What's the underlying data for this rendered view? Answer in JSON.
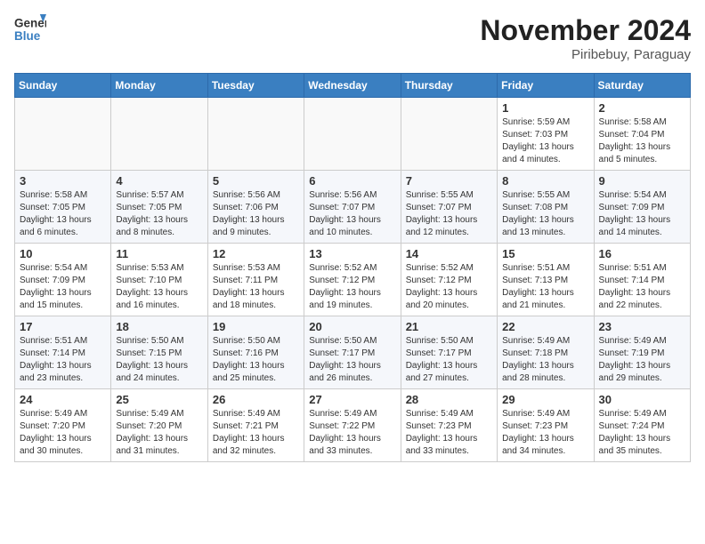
{
  "header": {
    "logo_general": "General",
    "logo_blue": "Blue",
    "month_title": "November 2024",
    "location": "Piribebuy, Paraguay"
  },
  "calendar": {
    "days_of_week": [
      "Sunday",
      "Monday",
      "Tuesday",
      "Wednesday",
      "Thursday",
      "Friday",
      "Saturday"
    ],
    "weeks": [
      [
        {
          "day": "",
          "info": ""
        },
        {
          "day": "",
          "info": ""
        },
        {
          "day": "",
          "info": ""
        },
        {
          "day": "",
          "info": ""
        },
        {
          "day": "",
          "info": ""
        },
        {
          "day": "1",
          "info": "Sunrise: 5:59 AM\nSunset: 7:03 PM\nDaylight: 13 hours\nand 4 minutes."
        },
        {
          "day": "2",
          "info": "Sunrise: 5:58 AM\nSunset: 7:04 PM\nDaylight: 13 hours\nand 5 minutes."
        }
      ],
      [
        {
          "day": "3",
          "info": "Sunrise: 5:58 AM\nSunset: 7:05 PM\nDaylight: 13 hours\nand 6 minutes."
        },
        {
          "day": "4",
          "info": "Sunrise: 5:57 AM\nSunset: 7:05 PM\nDaylight: 13 hours\nand 8 minutes."
        },
        {
          "day": "5",
          "info": "Sunrise: 5:56 AM\nSunset: 7:06 PM\nDaylight: 13 hours\nand 9 minutes."
        },
        {
          "day": "6",
          "info": "Sunrise: 5:56 AM\nSunset: 7:07 PM\nDaylight: 13 hours\nand 10 minutes."
        },
        {
          "day": "7",
          "info": "Sunrise: 5:55 AM\nSunset: 7:07 PM\nDaylight: 13 hours\nand 12 minutes."
        },
        {
          "day": "8",
          "info": "Sunrise: 5:55 AM\nSunset: 7:08 PM\nDaylight: 13 hours\nand 13 minutes."
        },
        {
          "day": "9",
          "info": "Sunrise: 5:54 AM\nSunset: 7:09 PM\nDaylight: 13 hours\nand 14 minutes."
        }
      ],
      [
        {
          "day": "10",
          "info": "Sunrise: 5:54 AM\nSunset: 7:09 PM\nDaylight: 13 hours\nand 15 minutes."
        },
        {
          "day": "11",
          "info": "Sunrise: 5:53 AM\nSunset: 7:10 PM\nDaylight: 13 hours\nand 16 minutes."
        },
        {
          "day": "12",
          "info": "Sunrise: 5:53 AM\nSunset: 7:11 PM\nDaylight: 13 hours\nand 18 minutes."
        },
        {
          "day": "13",
          "info": "Sunrise: 5:52 AM\nSunset: 7:12 PM\nDaylight: 13 hours\nand 19 minutes."
        },
        {
          "day": "14",
          "info": "Sunrise: 5:52 AM\nSunset: 7:12 PM\nDaylight: 13 hours\nand 20 minutes."
        },
        {
          "day": "15",
          "info": "Sunrise: 5:51 AM\nSunset: 7:13 PM\nDaylight: 13 hours\nand 21 minutes."
        },
        {
          "day": "16",
          "info": "Sunrise: 5:51 AM\nSunset: 7:14 PM\nDaylight: 13 hours\nand 22 minutes."
        }
      ],
      [
        {
          "day": "17",
          "info": "Sunrise: 5:51 AM\nSunset: 7:14 PM\nDaylight: 13 hours\nand 23 minutes."
        },
        {
          "day": "18",
          "info": "Sunrise: 5:50 AM\nSunset: 7:15 PM\nDaylight: 13 hours\nand 24 minutes."
        },
        {
          "day": "19",
          "info": "Sunrise: 5:50 AM\nSunset: 7:16 PM\nDaylight: 13 hours\nand 25 minutes."
        },
        {
          "day": "20",
          "info": "Sunrise: 5:50 AM\nSunset: 7:17 PM\nDaylight: 13 hours\nand 26 minutes."
        },
        {
          "day": "21",
          "info": "Sunrise: 5:50 AM\nSunset: 7:17 PM\nDaylight: 13 hours\nand 27 minutes."
        },
        {
          "day": "22",
          "info": "Sunrise: 5:49 AM\nSunset: 7:18 PM\nDaylight: 13 hours\nand 28 minutes."
        },
        {
          "day": "23",
          "info": "Sunrise: 5:49 AM\nSunset: 7:19 PM\nDaylight: 13 hours\nand 29 minutes."
        }
      ],
      [
        {
          "day": "24",
          "info": "Sunrise: 5:49 AM\nSunset: 7:20 PM\nDaylight: 13 hours\nand 30 minutes."
        },
        {
          "day": "25",
          "info": "Sunrise: 5:49 AM\nSunset: 7:20 PM\nDaylight: 13 hours\nand 31 minutes."
        },
        {
          "day": "26",
          "info": "Sunrise: 5:49 AM\nSunset: 7:21 PM\nDaylight: 13 hours\nand 32 minutes."
        },
        {
          "day": "27",
          "info": "Sunrise: 5:49 AM\nSunset: 7:22 PM\nDaylight: 13 hours\nand 33 minutes."
        },
        {
          "day": "28",
          "info": "Sunrise: 5:49 AM\nSunset: 7:23 PM\nDaylight: 13 hours\nand 33 minutes."
        },
        {
          "day": "29",
          "info": "Sunrise: 5:49 AM\nSunset: 7:23 PM\nDaylight: 13 hours\nand 34 minutes."
        },
        {
          "day": "30",
          "info": "Sunrise: 5:49 AM\nSunset: 7:24 PM\nDaylight: 13 hours\nand 35 minutes."
        }
      ]
    ]
  }
}
